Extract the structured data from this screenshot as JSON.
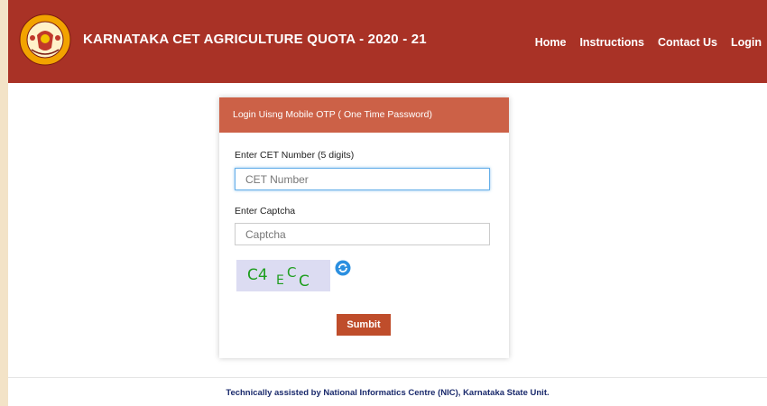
{
  "header": {
    "title": "KARNATAKA CET AGRICULTURE QUOTA - 2020 - 21",
    "emblem_text_top": "GOVERNMENT OF",
    "emblem_text_bottom": "KARNATAKA",
    "nav": [
      "Home",
      "Instructions",
      "Contact Us",
      "Login"
    ]
  },
  "login_card": {
    "title": "Login Uisng Mobile OTP ( One Time Password)",
    "cet_label": "Enter CET Number (5 digits)",
    "cet_placeholder": "CET Number",
    "cet_value": "",
    "captcha_label": "Enter Captcha",
    "captcha_placeholder": "Captcha",
    "captcha_value": "",
    "captcha_text": "C4ECC",
    "refresh_icon": "refresh-icon",
    "submit_label": "Sumbit"
  },
  "footer": {
    "text": "Technically assisted by National Informatics Centre (NIC), Karnataka State Unit."
  },
  "colors": {
    "header_bg": "#a93226",
    "card_header_bg": "#cc6147",
    "submit_bg": "#bf4d2b",
    "captcha_text": "#1e9e1e",
    "footer_text": "#1a2a6c"
  }
}
